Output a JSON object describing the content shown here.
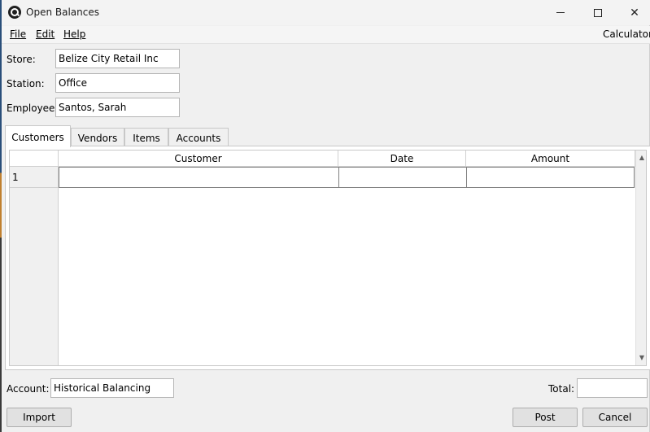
{
  "window": {
    "title": "Open Balances"
  },
  "menu": {
    "file": "File",
    "edit": "Edit",
    "help": "Help",
    "calculator": "Calculator"
  },
  "form": {
    "store_label": "Store:",
    "store_value": "Belize City Retail Inc",
    "station_label": "Station:",
    "station_value": "Office",
    "employee_label": "Employee:",
    "employee_value": "Santos, Sarah"
  },
  "tabs": [
    {
      "label": "Customers",
      "active": true
    },
    {
      "label": "Vendors",
      "active": false
    },
    {
      "label": "Items",
      "active": false
    },
    {
      "label": "Accounts",
      "active": false
    }
  ],
  "grid": {
    "columns": [
      "Customer",
      "Date",
      "Amount"
    ],
    "rows": [
      {
        "number": "1",
        "customer": "",
        "date": "",
        "amount": ""
      }
    ]
  },
  "footer": {
    "account_label": "Account:",
    "account_value": "Historical Balancing",
    "total_label": "Total:",
    "total_value": "",
    "import_label": "Import",
    "post_label": "Post",
    "cancel_label": "Cancel"
  },
  "icons": {
    "app": "app-logo-icon",
    "minimize": "minimize-icon",
    "maximize": "maximize-icon",
    "close": "close-icon",
    "scroll_up": "scroll-up-arrow-icon",
    "scroll_down": "scroll-down-arrow-icon"
  }
}
